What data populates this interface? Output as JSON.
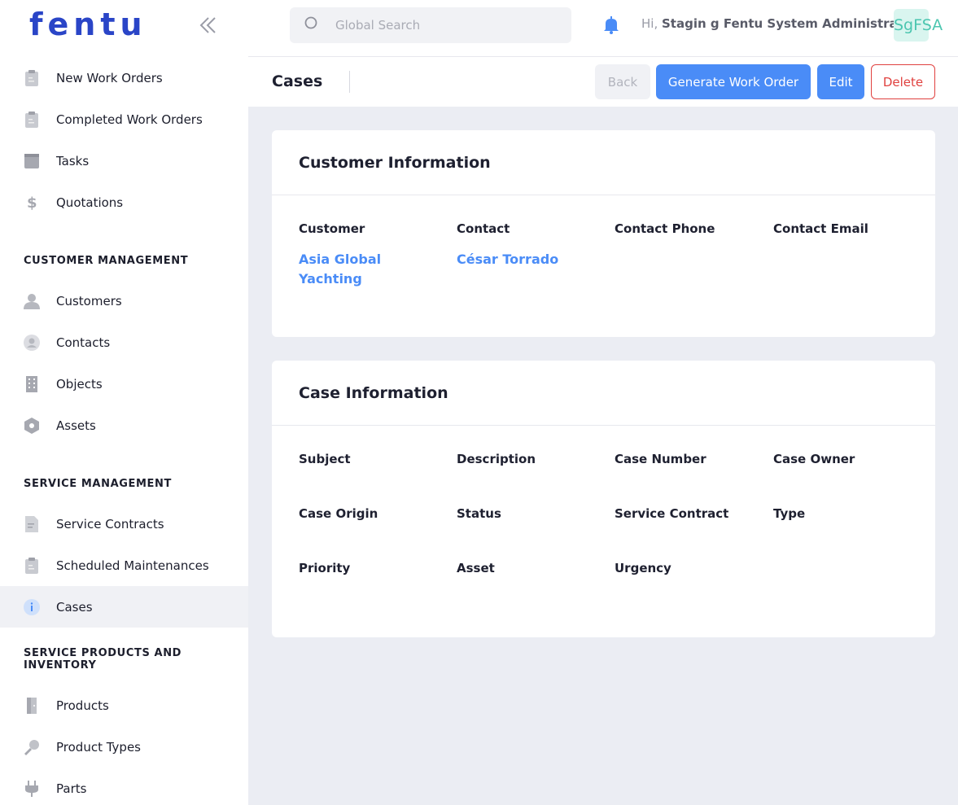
{
  "brand": {
    "logo_text": "fentu"
  },
  "sidebar": {
    "items_top": [
      {
        "label": "New Work Orders",
        "icon": "clipboard-icon"
      },
      {
        "label": "Completed Work Orders",
        "icon": "clipboard-icon"
      },
      {
        "label": "Tasks",
        "icon": "book-icon"
      },
      {
        "label": "Quotations",
        "icon": "dollar-icon"
      }
    ],
    "section_customer": "CUSTOMER MANAGEMENT",
    "items_customer": [
      {
        "label": "Customers",
        "icon": "person-icon"
      },
      {
        "label": "Contacts",
        "icon": "contact-icon"
      },
      {
        "label": "Objects",
        "icon": "building-icon"
      },
      {
        "label": "Assets",
        "icon": "hexagon-icon"
      }
    ],
    "section_service": "SERVICE MANAGEMENT",
    "items_service": [
      {
        "label": "Service Contracts",
        "icon": "document-icon"
      },
      {
        "label": "Scheduled Maintenances",
        "icon": "clipboard-icon"
      },
      {
        "label": "Cases",
        "icon": "info-icon",
        "active": true
      }
    ],
    "section_products": "SERVICE PRODUCTS AND INVENTORY",
    "items_products": [
      {
        "label": "Products",
        "icon": "box-icon"
      },
      {
        "label": "Product Types",
        "icon": "key-icon"
      },
      {
        "label": "Parts",
        "icon": "plug-icon"
      }
    ]
  },
  "header": {
    "search_placeholder": "Global Search",
    "greeting_prefix": "Hi,",
    "user_name": "Stagin g Fentu System Administrator",
    "avatar_initials": "SgFSA"
  },
  "page": {
    "title": "Cases",
    "buttons": {
      "back": "Back",
      "generate": "Generate Work Order",
      "edit": "Edit",
      "delete": "Delete"
    }
  },
  "customer_info": {
    "title": "Customer Information",
    "labels": {
      "customer": "Customer",
      "contact": "Contact",
      "contact_phone": "Contact Phone",
      "contact_email": "Contact Email"
    },
    "values": {
      "customer_line1": "Asia Global",
      "customer_line2": "Yachting",
      "contact": "César Torrado"
    }
  },
  "case_info": {
    "title": "Case Information",
    "labels": {
      "subject": "Subject",
      "description": "Description",
      "case_number": "Case Number",
      "case_owner": "Case Owner",
      "case_origin": "Case Origin",
      "status": "Status",
      "service_contract": "Service Contract",
      "type": "Type",
      "priority": "Priority",
      "asset": "Asset",
      "urgency": "Urgency"
    }
  },
  "colors": {
    "accent": "#4a8cf7",
    "danger": "#e0413f",
    "brand": "#2a45c7"
  }
}
